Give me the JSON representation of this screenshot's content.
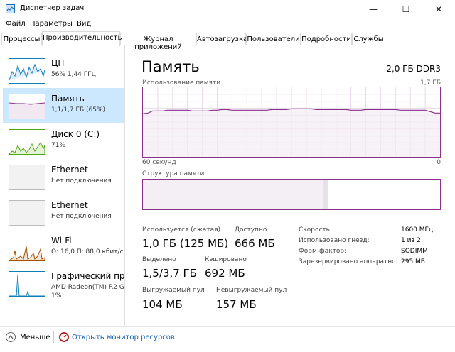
{
  "window": {
    "title": "Диспетчер задач",
    "controls": {
      "minimize": "—",
      "maximize": "☐",
      "close": "✕"
    }
  },
  "menu": [
    "Файл",
    "Параметры",
    "Вид"
  ],
  "tabs": [
    {
      "label": "Процессы",
      "active": false
    },
    {
      "label": "Производительность",
      "active": true
    },
    {
      "label": "Журнал приложений",
      "active": false
    },
    {
      "label": "Автозагрузка",
      "active": false
    },
    {
      "label": "Пользователи",
      "active": false
    },
    {
      "label": "Подробности",
      "active": false
    },
    {
      "label": "Службы",
      "active": false
    }
  ],
  "sidebar": {
    "items": [
      {
        "name": "ЦП",
        "sub": "56% 1,44 ГГц",
        "sub2": "",
        "color": "#117dbb"
      },
      {
        "name": "Память",
        "sub": "1,1/1,7 ГБ (65%)",
        "sub2": "",
        "color": "#8b318b",
        "selected": true
      },
      {
        "name": "Диск 0 (C:)",
        "sub": "71%",
        "sub2": "",
        "color": "#4da60c"
      },
      {
        "name": "Ethernet",
        "sub": "Нет подключения",
        "sub2": "",
        "color": "#999999"
      },
      {
        "name": "Ethernet",
        "sub": "Нет подключения",
        "sub2": "",
        "color": "#999999"
      },
      {
        "name": "Wi-Fi",
        "sub": "О: 16,0 П: 88,0 кбит/с",
        "sub2": "",
        "color": "#a74f01"
      },
      {
        "name": "Графический проц",
        "sub": "AMD Radeon(TM) R2 Gr",
        "sub2": "1%",
        "color": "#117dbb"
      }
    ]
  },
  "main": {
    "title": "Память",
    "spec": "2,0 ГБ DDR3",
    "usage_label": "Использование памяти",
    "usage_max": "1,7 ГБ",
    "time_left": "60 секунд",
    "time_right": "0",
    "structure_label": "Структура памяти",
    "stats": {
      "in_use_label": "Используется (сжатая)",
      "in_use": "1,0 ГБ (125 МБ)",
      "available_label": "Доступно",
      "available": "666 МБ",
      "committed_label": "Выделено",
      "committed": "1,5/3,7 ГБ",
      "cached_label": "Кэшировано",
      "cached": "692 МБ",
      "paged_label": "Выгружаемый пул",
      "paged": "104 МБ",
      "nonpaged_label": "Невыгружаемый пул",
      "nonpaged": "157 МБ"
    },
    "props": [
      {
        "label": "Скорость:",
        "value": "1600 МГц"
      },
      {
        "label": "Использовано гнезд:",
        "value": "1 из 2"
      },
      {
        "label": "Форм-фактор:",
        "value": "SODIMM"
      },
      {
        "label": "Зарезервировано аппаратно:",
        "value": "295 МБ"
      }
    ]
  },
  "footer": {
    "less": "Меньше",
    "monitor": "Открыть монитор ресурсов"
  },
  "colors": {
    "memory": "#8b318b",
    "select": "#cce8ff",
    "link": "#1a5fb4"
  },
  "chart_data": {
    "type": "line",
    "series": [
      {
        "values": [
          62,
          63,
          66,
          66,
          66,
          67,
          67,
          67,
          67,
          67,
          66,
          66,
          66,
          66,
          67,
          67,
          68,
          68,
          67,
          67,
          67,
          67,
          67,
          67,
          67,
          67,
          68,
          68,
          68,
          68,
          69,
          69,
          69,
          69,
          69,
          68,
          68,
          68,
          68,
          68,
          68,
          68,
          67,
          67,
          67,
          68,
          68,
          68,
          68,
          68,
          68,
          68,
          67,
          67,
          67,
          67,
          67,
          67,
          65,
          63,
          63
        ]
      }
    ],
    "ylim": [
      0,
      100
    ],
    "grid": true
  }
}
